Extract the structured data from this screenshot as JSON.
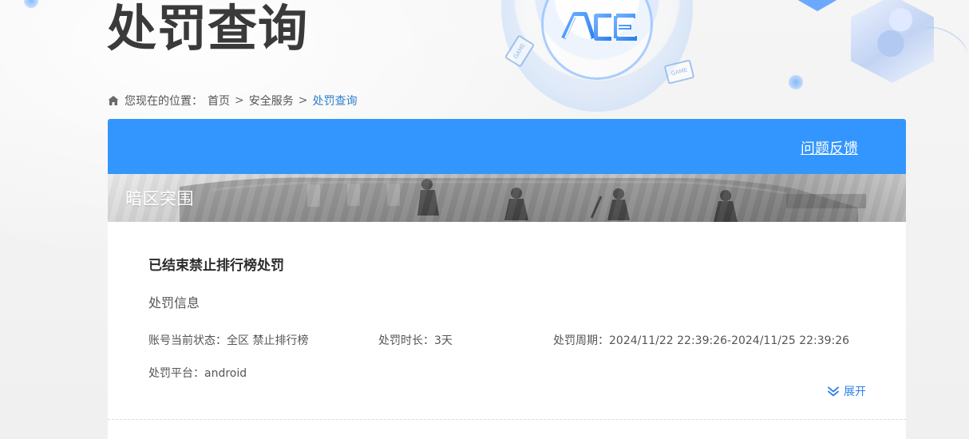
{
  "page": {
    "title": "处罚查询"
  },
  "breadcrumb": {
    "prefix": "您现在的位置：",
    "items": [
      "首页",
      "安全服务",
      "处罚查询"
    ],
    "separator": ">"
  },
  "header": {
    "feedback_label": "问题反馈"
  },
  "game": {
    "banner_title": "暗区突围"
  },
  "record": {
    "title": "已结束禁止排行榜处罚",
    "section_label": "处罚信息",
    "status_label": "账号当前状态：",
    "status_value": "全区 禁止排行榜",
    "duration_label": "处罚时长：",
    "duration_value": "3天",
    "period_label": "处罚周期：",
    "period_value": "2024/11/22 22:39:26-2024/11/25 22:39:26",
    "platform_label": "处罚平台：",
    "platform_value": "android",
    "expand_label": "展开"
  },
  "decor": {
    "game_badge_text": "GAME",
    "accent_color": "#3396ff",
    "link_color": "#2e7fcb",
    "icons": {
      "home": "home-icon",
      "expand": "double-chevron-down-icon",
      "logo": "ace-logo"
    }
  }
}
